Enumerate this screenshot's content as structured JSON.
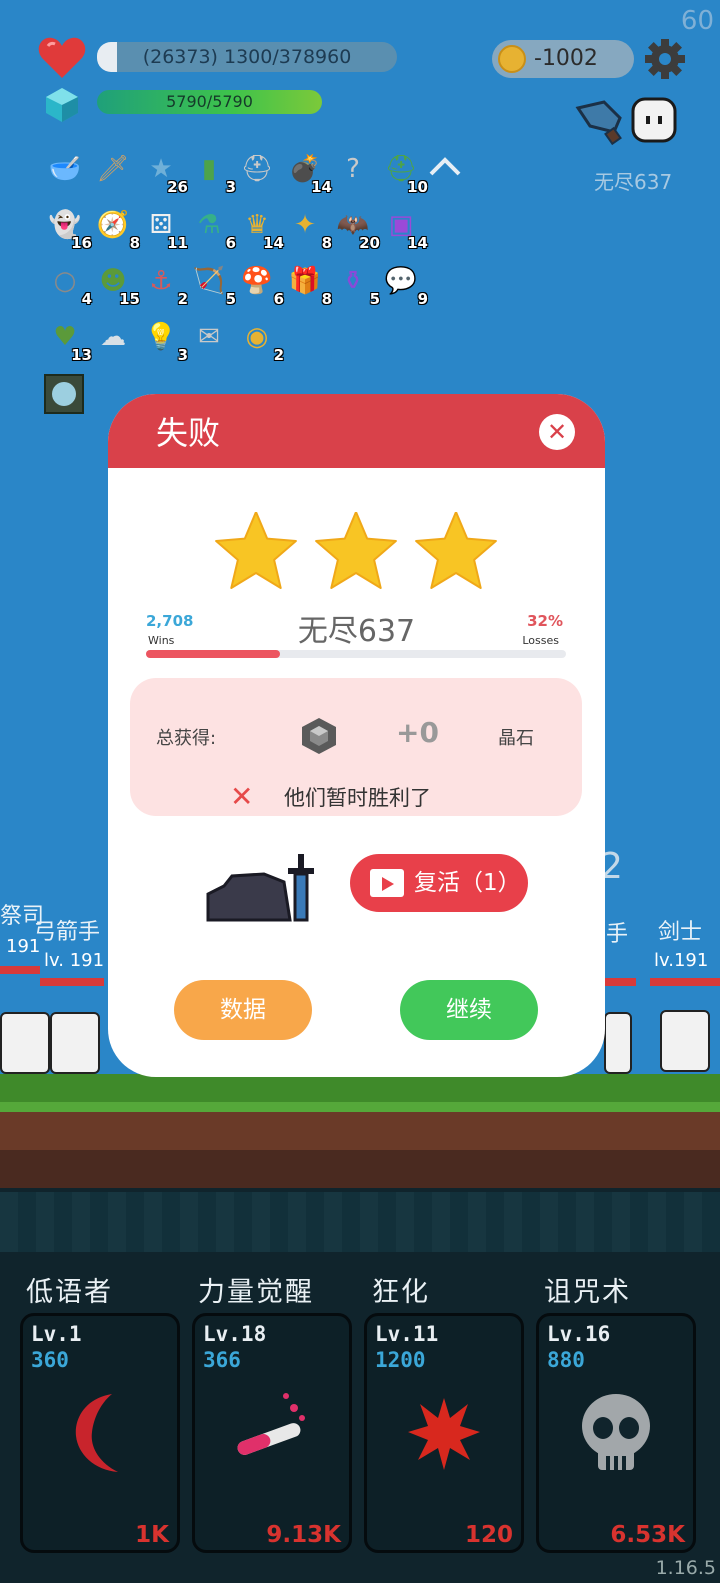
{
  "hud": {
    "fps": "60",
    "hp_text": "(26373) 1300/378960",
    "mp_text": "5790/5790",
    "gold": "-1002",
    "endless_label": "无尽637"
  },
  "inventory": [
    {
      "icon": "mortar-icon",
      "count": ""
    },
    {
      "icon": "sword-icon",
      "count": ""
    },
    {
      "icon": "star-card-icon",
      "count": "26"
    },
    {
      "icon": "green-card-icon",
      "count": "3"
    },
    {
      "icon": "viking-helmet-icon",
      "count": ""
    },
    {
      "icon": "grenade-icon",
      "count": "14"
    },
    {
      "icon": "question-mark-icon",
      "count": ""
    },
    {
      "icon": "green-helmet-icon",
      "count": "10"
    },
    {
      "icon": "ghost-icon",
      "count": "16"
    },
    {
      "icon": "compass-icon",
      "count": "8"
    },
    {
      "icon": "dice-icon",
      "count": "11"
    },
    {
      "icon": "flask-icon",
      "count": "6"
    },
    {
      "icon": "crown-icon",
      "count": "14"
    },
    {
      "icon": "magic-wand-icon",
      "count": "8"
    },
    {
      "icon": "bat-icon",
      "count": "20"
    },
    {
      "icon": "purple-box-icon",
      "count": "14"
    },
    {
      "icon": "noose-icon",
      "count": "4"
    },
    {
      "icon": "goblin-icon",
      "count": "15"
    },
    {
      "icon": "hook-icon",
      "count": "2"
    },
    {
      "icon": "bow-icon",
      "count": "5"
    },
    {
      "icon": "mushroom-icon",
      "count": "6"
    },
    {
      "icon": "gift-icon",
      "count": "8"
    },
    {
      "icon": "potion-icon",
      "count": "5"
    },
    {
      "icon": "chat-bubble-icon",
      "count": "9"
    },
    {
      "icon": "money-heart-icon",
      "count": "13"
    },
    {
      "icon": "cloud-icon",
      "count": ""
    },
    {
      "icon": "bulb-icon",
      "count": "3"
    },
    {
      "icon": "envelope-icon",
      "count": ""
    },
    {
      "icon": "coin-stack-icon",
      "count": "2"
    }
  ],
  "battle": {
    "left_name1": "祭司",
    "left_name2": "弓箭手",
    "left_lv1": "191",
    "left_lv2": "lv. 191",
    "right_name1": "手",
    "right_name2": "剑士",
    "right_lv": "lv.191",
    "big_number": "2"
  },
  "modal": {
    "title": "失败",
    "close": "✕",
    "stars": 3,
    "wins_value": "2,708",
    "wins_label": "Wins",
    "losses_value": "32%",
    "losses_label": "Losses",
    "level_name": "无尽637",
    "progress_fraction": 0.32,
    "gain_label": "总获得:",
    "gain_value": "+0",
    "gain_unit": "晶石",
    "defeat_message": "他们暂时胜利了",
    "revive_label": "复活（1）",
    "stats_button": "数据",
    "continue_button": "继续"
  },
  "skills": [
    {
      "name": "低语者",
      "level": "Lv.1",
      "cost": "360",
      "value": "1K",
      "icon": "moon-icon",
      "color": "#c8242c"
    },
    {
      "name": "力量觉醒",
      "level": "Lv.18",
      "cost": "366",
      "value": "9.13K",
      "icon": "potion-tube-icon",
      "color": "#e0306a"
    },
    {
      "name": "狂化",
      "level": "Lv.11",
      "cost": "1200",
      "value": "120",
      "icon": "blood-splat-icon",
      "color": "#d8281e"
    },
    {
      "name": "诅咒术",
      "level": "Lv.16",
      "cost": "880",
      "value": "6.53K",
      "icon": "skull-icon",
      "color": "#9aa0a4"
    }
  ],
  "version": "1.16.5"
}
